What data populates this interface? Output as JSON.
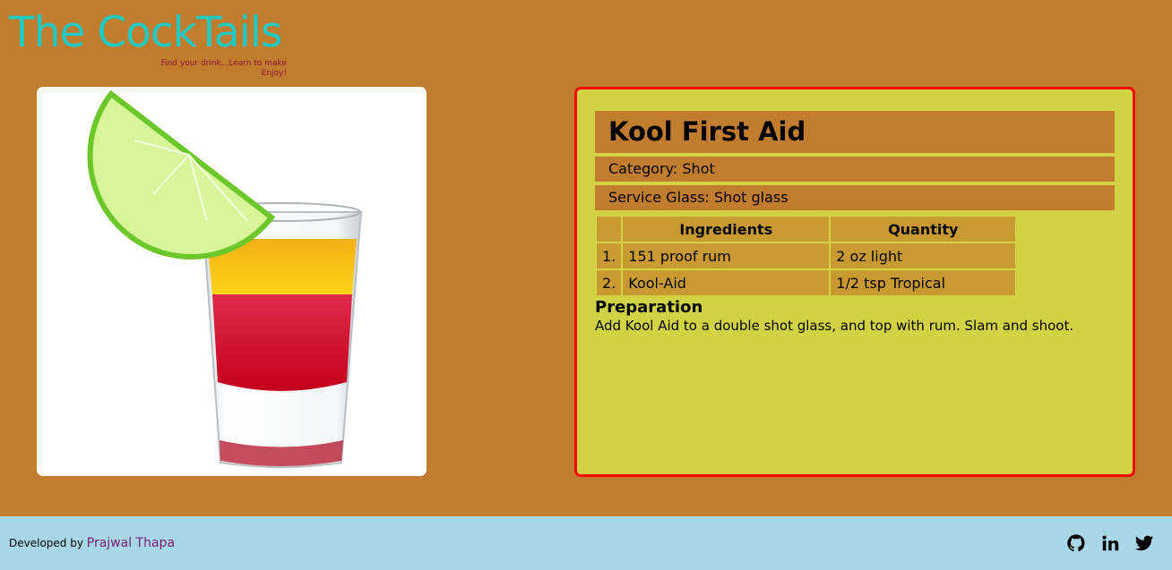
{
  "header": {
    "title": "The CockTails",
    "tagline_1": "Find your drink...Learn to make",
    "tagline_2": "Enjoy!"
  },
  "drink": {
    "name": "Kool First Aid",
    "category": "Category: Shot",
    "glass": "Service Glass: Shot glass",
    "table_headers": [
      "",
      "Ingredients",
      "Quantity"
    ],
    "ingredients": [
      {
        "num": "1.",
        "name": "151 proof rum",
        "qty": "2 oz light"
      },
      {
        "num": "2.",
        "name": "Kool-Aid",
        "qty": "1/2 tsp Tropical"
      }
    ],
    "prep_title": "Preparation",
    "prep_text": "Add Kool Aid to a double shot glass, and top with rum. Slam and shoot."
  },
  "footer": {
    "developed_by": "Developed by",
    "developer": "Prajwal Thapa",
    "social_icons": [
      "github-icon",
      "linkedin-icon",
      "twitter-icon"
    ]
  },
  "colors": {
    "background": "#c17c2e",
    "title": "#20c9c2",
    "panel": "#d2d344",
    "panel_border": "#ff0000",
    "footer": "#a8d8e8"
  }
}
